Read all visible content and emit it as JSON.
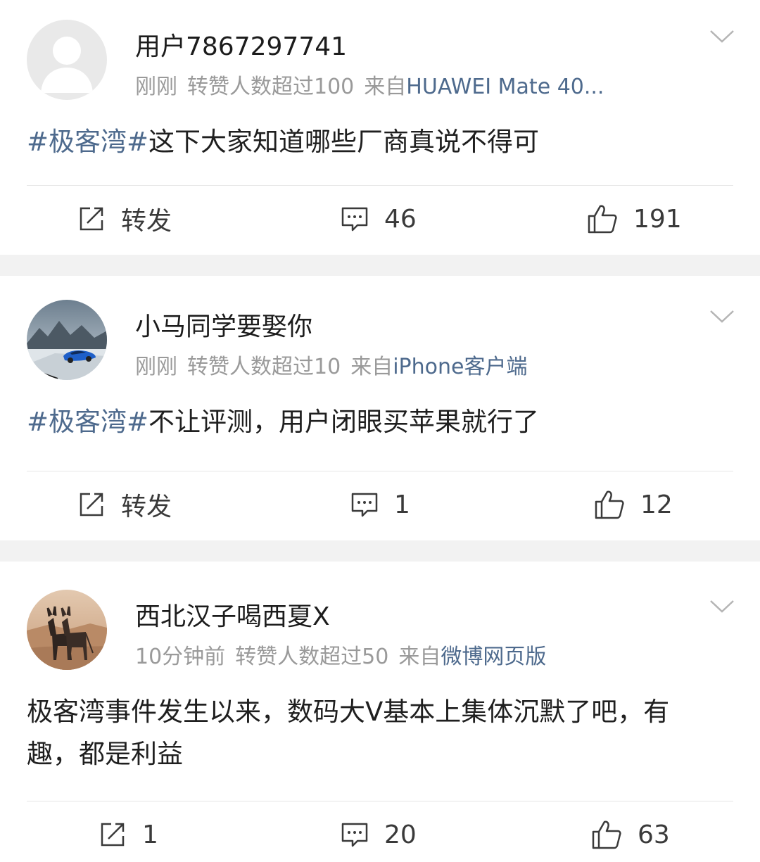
{
  "posts": [
    {
      "username": "用户7867297741",
      "time": "刚刚",
      "reposts_info": "转赞人数超过100",
      "source_label": "来自",
      "source_name": "HUAWEI Mate 40...",
      "topic": "#极客湾#",
      "text": "这下大家知道哪些厂商真说不得可",
      "repost_label": "转发",
      "comments": "46",
      "likes": "191",
      "avatar": "default-avatar"
    },
    {
      "username": "小马同学要娶你",
      "time": "刚刚",
      "reposts_info": "转赞人数超过10",
      "source_label": "来自",
      "source_name": "iPhone客户端",
      "topic": "#极客湾#",
      "text": "不让评测，用户闭眼买苹果就行了",
      "repost_label": "转发",
      "comments": "1",
      "likes": "12",
      "avatar": "car-landscape-avatar"
    },
    {
      "username": "西北汉子喝西夏X",
      "time": "10分钟前",
      "reposts_info": "转赞人数超过50",
      "source_label": "来自",
      "source_name": "微博网页版",
      "topic": "",
      "text": "极客湾事件发生以来，数码大V基本上集体沉默了吧，有趣，都是利益",
      "repost_label": "1",
      "comments": "20",
      "likes": "63",
      "avatar": "donkeys-avatar"
    }
  ],
  "colors": {
    "link": "#4e6a8d",
    "meta": "#9a9a9a",
    "text": "#1f1f1f",
    "separator": "#f2f2f2"
  }
}
